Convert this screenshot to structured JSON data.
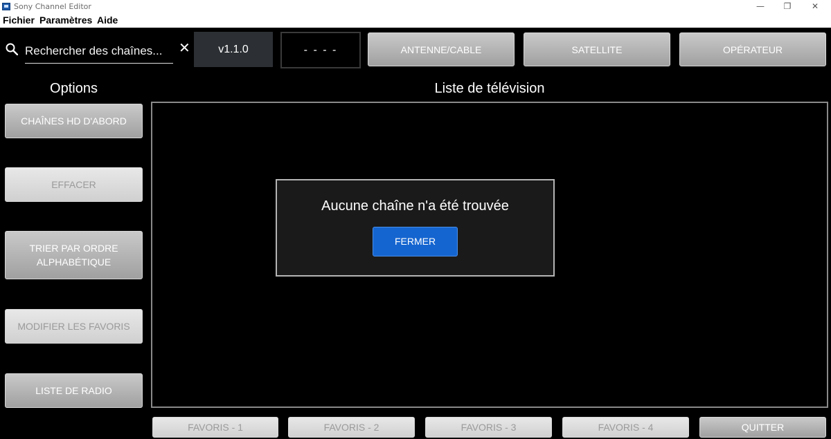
{
  "window": {
    "title": "Sony Channel Editor",
    "minimize": "—",
    "restore": "❐",
    "close": "✕"
  },
  "menu": {
    "items": [
      "Fichier",
      "Paramètres",
      "Aide"
    ]
  },
  "search": {
    "placeholder": "Rechercher des chaînes...",
    "value": "",
    "clear_icon": "✕"
  },
  "toolbar": {
    "version": "v1.1.0",
    "status": "- - - -",
    "source_buttons": [
      "ANTENNE/CABLE",
      "SATELLITE",
      "OPÉRATEUR"
    ]
  },
  "options": {
    "title": "Options",
    "buttons": [
      {
        "label": "CHAÎNES HD D'ABORD",
        "enabled": true
      },
      {
        "label": "EFFACER",
        "enabled": false
      },
      {
        "label": "TRIER PAR ORDRE ALPHABÉTIQUE",
        "enabled": true
      },
      {
        "label": "MODIFIER LES FAVORIS",
        "enabled": false
      },
      {
        "label": "LISTE DE RADIO",
        "enabled": true
      }
    ]
  },
  "tv_list": {
    "title": "Liste de télévision"
  },
  "dialog": {
    "message": "Aucune chaîne n'a été trouvée",
    "button": "FERMER",
    "button_color": "#1565d0"
  },
  "bottom": {
    "favorites": [
      "FAVORIS - 1",
      "FAVORIS - 2",
      "FAVORIS - 3",
      "FAVORIS - 4"
    ],
    "quit": "QUITTER"
  }
}
